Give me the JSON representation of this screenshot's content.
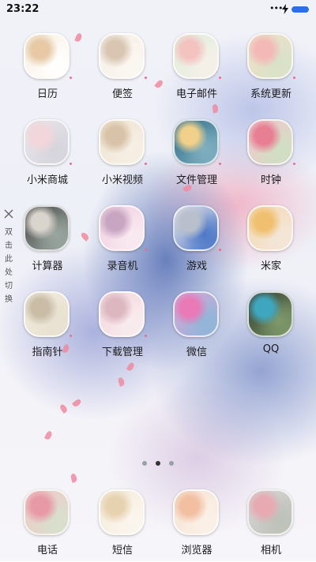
{
  "status_bar": {
    "time": "23:22",
    "signal_dots": "•••"
  },
  "side_hint": {
    "text": "双击此处切换"
  },
  "apps": [
    {
      "label": "日历",
      "icon": "calendar-flowers-icon",
      "colors": [
        "#f7efe0",
        "#e7c9a6",
        "#ffffff"
      ]
    },
    {
      "label": "便签",
      "icon": "notes-teacup-icon",
      "colors": [
        "#f4eee6",
        "#d8c6b2",
        "#fbf7f1"
      ]
    },
    {
      "label": "电子邮件",
      "icon": "email-flower-icon",
      "colors": [
        "#dfeedd",
        "#f4c3c0",
        "#f5f0e8"
      ]
    },
    {
      "label": "系统更新",
      "icon": "system-update-flower-icon",
      "colors": [
        "#efe0c8",
        "#f3b9b6",
        "#d8e2c8"
      ]
    },
    {
      "label": "小米商城",
      "icon": "mi-store-petals-icon",
      "colors": [
        "#e8e6ea",
        "#f1d6dc",
        "#d6d5dc"
      ]
    },
    {
      "label": "小米视频",
      "icon": "mi-video-heart-icon",
      "colors": [
        "#efe4d2",
        "#d8c2a8",
        "#f6efe4"
      ]
    },
    {
      "label": "文件管理",
      "icon": "file-manager-flower-icon",
      "colors": [
        "#2f6e8a",
        "#f0d08a",
        "#7fb0c0"
      ]
    },
    {
      "label": "时钟",
      "icon": "clock-flower-icon",
      "colors": [
        "#f2c6cf",
        "#e77f93",
        "#cfe0c2"
      ]
    },
    {
      "label": "计算器",
      "icon": "calculator-photo-icon",
      "colors": [
        "#4a4a4a",
        "#d9d4cc",
        "#9aa7a0"
      ]
    },
    {
      "label": "录音机",
      "icon": "recorder-eiffel-icon",
      "colors": [
        "#f2cfe0",
        "#c8a6c2",
        "#f8eaf0"
      ]
    },
    {
      "label": "游戏",
      "icon": "games-rings-icon",
      "colors": [
        "#e8e6e8",
        "#b9c0cc",
        "#4d78c8"
      ]
    },
    {
      "label": "米家",
      "icon": "mijia-roses-icon",
      "colors": [
        "#f5d9b4",
        "#f0c070",
        "#f3e6d8"
      ]
    },
    {
      "label": "指南针",
      "icon": "compass-handwriting-icon",
      "colors": [
        "#f1ece0",
        "#c9bda6",
        "#e8e0d0"
      ]
    },
    {
      "label": "下载管理",
      "icon": "downloads-trees-icon",
      "colors": [
        "#f4d7dc",
        "#dcb7c0",
        "#f8ecee"
      ]
    },
    {
      "label": "微信",
      "icon": "wechat-cosmos-icon",
      "colors": [
        "#d8a6d8",
        "#e979b7",
        "#8fb6d8"
      ]
    },
    {
      "label": "QQ",
      "icon": "qq-forgetmenot-icon",
      "colors": [
        "#2f3a2f",
        "#3fa6c0",
        "#7f9a6a"
      ]
    }
  ],
  "dock": [
    {
      "label": "电话",
      "icon": "phone-flowers-icon",
      "colors": [
        "#f2c8c8",
        "#e79aa6",
        "#d7e0cc"
      ]
    },
    {
      "label": "短信",
      "icon": "messages-flowers-icon",
      "colors": [
        "#f4ead8",
        "#e7d2b0",
        "#fbf6ee"
      ]
    },
    {
      "label": "浏览器",
      "icon": "browser-roses-icon",
      "colors": [
        "#f6e2d2",
        "#f2bfa0",
        "#fbf1e8"
      ]
    },
    {
      "label": "相机",
      "icon": "camera-roses-icon",
      "colors": [
        "#d9d6d6",
        "#e7aab2",
        "#bcc2b8"
      ]
    }
  ]
}
